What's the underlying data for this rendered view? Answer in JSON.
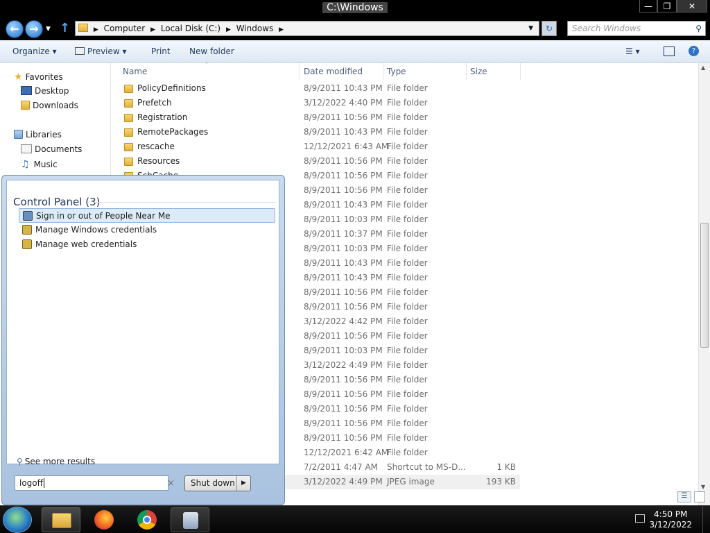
{
  "window": {
    "title": "C:\\Windows"
  },
  "address": {
    "crumbs": [
      "Computer",
      "Local Disk (C:)",
      "Windows"
    ],
    "search_placeholder": "Search Windows"
  },
  "toolbar": {
    "organize": "Organize",
    "preview": "Preview",
    "print": "Print",
    "new_folder": "New folder"
  },
  "nav": {
    "favorites": "Favorites",
    "desktop": "Desktop",
    "downloads": "Downloads",
    "libraries": "Libraries",
    "documents": "Documents",
    "music": "Music"
  },
  "columns": {
    "name": "Name",
    "date": "Date modified",
    "type": "Type",
    "size": "Size"
  },
  "rows": [
    {
      "name": "PolicyDefinitions",
      "date": "8/9/2011 10:43 PM",
      "type": "File folder",
      "size": ""
    },
    {
      "name": "Prefetch",
      "date": "3/12/2022 4:40 PM",
      "type": "File folder",
      "size": ""
    },
    {
      "name": "Registration",
      "date": "8/9/2011 10:56 PM",
      "type": "File folder",
      "size": ""
    },
    {
      "name": "RemotePackages",
      "date": "8/9/2011 10:43 PM",
      "type": "File folder",
      "size": ""
    },
    {
      "name": "rescache",
      "date": "12/12/2021 6:43 AM",
      "type": "File folder",
      "size": ""
    },
    {
      "name": "Resources",
      "date": "8/9/2011 10:56 PM",
      "type": "File folder",
      "size": ""
    },
    {
      "name": "SchCache",
      "date": "8/9/2011 10:56 PM",
      "type": "File folder",
      "size": ""
    },
    {
      "name": "",
      "date": "8/9/2011 10:56 PM",
      "type": "File folder",
      "size": ""
    },
    {
      "name": "",
      "date": "8/9/2011 10:43 PM",
      "type": "File folder",
      "size": ""
    },
    {
      "name": "",
      "date": "8/9/2011 10:03 PM",
      "type": "File folder",
      "size": ""
    },
    {
      "name": "",
      "date": "8/9/2011 10:37 PM",
      "type": "File folder",
      "size": ""
    },
    {
      "name": "",
      "date": "8/9/2011 10:03 PM",
      "type": "File folder",
      "size": ""
    },
    {
      "name": "",
      "date": "8/9/2011 10:43 PM",
      "type": "File folder",
      "size": ""
    },
    {
      "name": "",
      "date": "8/9/2011 10:43 PM",
      "type": "File folder",
      "size": ""
    },
    {
      "name": "",
      "date": "8/9/2011 10:56 PM",
      "type": "File folder",
      "size": ""
    },
    {
      "name": "",
      "date": "8/9/2011 10:56 PM",
      "type": "File folder",
      "size": ""
    },
    {
      "name": "",
      "date": "3/12/2022 4:42 PM",
      "type": "File folder",
      "size": ""
    },
    {
      "name": "",
      "date": "8/9/2011 10:56 PM",
      "type": "File folder",
      "size": ""
    },
    {
      "name": "",
      "date": "8/9/2011 10:03 PM",
      "type": "File folder",
      "size": ""
    },
    {
      "name": "",
      "date": "3/12/2022 4:49 PM",
      "type": "File folder",
      "size": ""
    },
    {
      "name": "",
      "date": "8/9/2011 10:56 PM",
      "type": "File folder",
      "size": ""
    },
    {
      "name": "",
      "date": "8/9/2011 10:56 PM",
      "type": "File folder",
      "size": ""
    },
    {
      "name": "",
      "date": "8/9/2011 10:56 PM",
      "type": "File folder",
      "size": ""
    },
    {
      "name": "",
      "date": "8/9/2011 10:56 PM",
      "type": "File folder",
      "size": ""
    },
    {
      "name": "",
      "date": "8/9/2011 10:56 PM",
      "type": "File folder",
      "size": ""
    },
    {
      "name": "",
      "date": "12/12/2021 6:42 AM",
      "type": "File folder",
      "size": ""
    },
    {
      "name": "",
      "date": "7/2/2011 4:47 AM",
      "type": "Shortcut to MS-D...",
      "size": "1 KB"
    },
    {
      "name": "",
      "date": "3/12/2022 4:49 PM",
      "type": "JPEG image",
      "size": "193 KB"
    }
  ],
  "start_menu": {
    "section": "Control Panel (3)",
    "results": [
      "Sign in or out of People Near Me",
      "Manage Windows credentials",
      "Manage web credentials"
    ],
    "see_more": "See more results",
    "search_value": "logoff",
    "shutdown": "Shut down"
  },
  "clock": {
    "time": "4:50 PM",
    "date": "3/12/2022"
  }
}
